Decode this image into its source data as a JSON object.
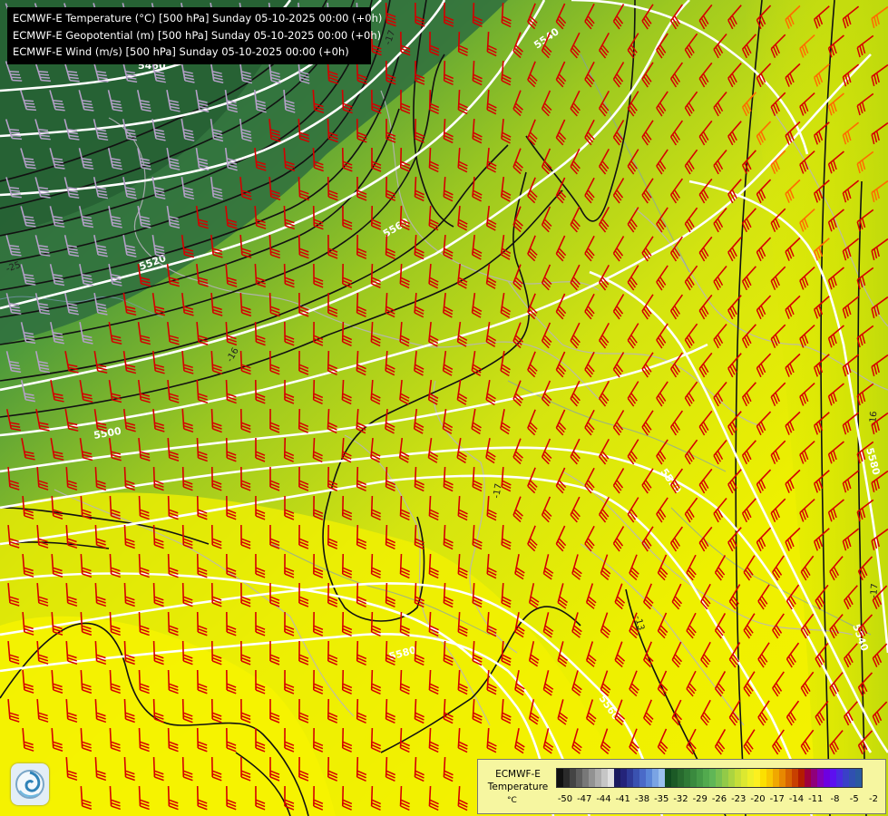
{
  "titles": [
    "ECMWF-E Temperature (°C) [500 hPa] Sunday 05-10-2025 00:00 (+0h)",
    "ECMWF-E Geopotential (m) [500 hPa] Sunday 05-10-2025 00:00 (+0h)",
    "ECMWF-E Wind (m/s) [500 hPa] Sunday 05-10-2025 00:00 (+0h)"
  ],
  "geopotential_labels": [
    "5460",
    "5520",
    "5540",
    "5560",
    "5500",
    "5520",
    "5580",
    "5540",
    "5560",
    "5580"
  ],
  "isotherm_labels": [
    "-17",
    "-25",
    "-16",
    "-17",
    "-13",
    "-16",
    "-17"
  ],
  "legend": {
    "title": "ECMWF-E\nTemperature",
    "unit": "°C",
    "ticks": [
      "-50",
      "-47",
      "-44",
      "-41",
      "-38",
      "-35",
      "-32",
      "-29",
      "-26",
      "-23",
      "-20",
      "-17",
      "-14",
      "-11",
      "-8",
      "-5",
      "-2"
    ],
    "colors": [
      "#101010",
      "#2a2a2a",
      "#444",
      "#5e5e5e",
      "#787878",
      "#929292",
      "#acacac",
      "#c6c6c6",
      "#e0e0e0",
      "#1a1a5e",
      "#24247a",
      "#2e3a96",
      "#3a52b0",
      "#4a6ac8",
      "#5a86d8",
      "#7aa4e4",
      "#9ac0ee",
      "#0f4a1e",
      "#1c5a26",
      "#276a2e",
      "#307a36",
      "#3a8a3e",
      "#459a46",
      "#52aa4e",
      "#60b656",
      "#78c050",
      "#92ca48",
      "#acd440",
      "#c6de38",
      "#dce830",
      "#eef028",
      "#fcf020",
      "#fce000",
      "#f8c800",
      "#f0a800",
      "#e88800",
      "#d86400",
      "#c84000",
      "#b41c00",
      "#a0003c",
      "#90007a",
      "#8000b8",
      "#6e00e0",
      "#5c10f0",
      "#4a2ae0",
      "#3a40c8",
      "#3050b0",
      "#2a5aa0"
    ],
    "accent_wind": "#d40000",
    "accent_wind_strong": "#ff6a00",
    "accent_wind_weak": "#b4a0c8"
  }
}
